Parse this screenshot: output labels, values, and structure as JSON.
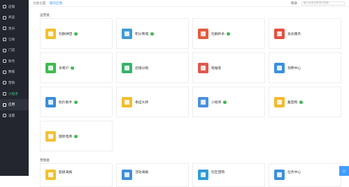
{
  "sidebar": {
    "items": [
      {
        "label": "店铺",
        "icon": "shop-icon",
        "active": false
      },
      {
        "label": "商品",
        "icon": "goods-icon",
        "active": false
      },
      {
        "label": "会员",
        "icon": "member-icon",
        "active": false
      },
      {
        "label": "订单",
        "icon": "order-icon",
        "active": false
      },
      {
        "label": "门店",
        "icon": "store-icon",
        "active": false
      },
      {
        "label": "财务",
        "icon": "finance-icon",
        "active": false
      },
      {
        "label": "数据",
        "icon": "data-icon",
        "active": false
      },
      {
        "label": "营销",
        "icon": "marketing-icon",
        "active": false
      },
      {
        "label": "小程序",
        "icon": "miniapp-icon",
        "active": false,
        "highlight": true
      },
      {
        "label": "应用",
        "icon": "apps-icon",
        "active": true
      },
      {
        "label": "设置",
        "icon": "settings-icon",
        "active": false
      }
    ]
  },
  "topbar": {
    "breadcrumb_prefix": "功能位置:",
    "breadcrumb_current": "我的应用",
    "help_label": "帮助",
    "search_placeholder": "输入应用名称进行检索"
  },
  "sections": [
    {
      "title": "运营类",
      "apps": [
        {
          "name": "社群拼团",
          "color": "#f2c12e",
          "icon": "group-buy-icon",
          "installed": true
        },
        {
          "name": "积分商城",
          "color": "#3e9bd6",
          "icon": "points-mall-icon",
          "installed": true
        },
        {
          "name": "社群秒杀",
          "color": "#e55b3c",
          "icon": "flash-sale-icon",
          "installed": true
        },
        {
          "name": "会员服务",
          "color": "#e84e3f",
          "icon": "member-service-icon",
          "installed": false
        },
        {
          "name": "多商户",
          "color": "#3dbb4f",
          "icon": "multi-merchant-icon",
          "installed": true
        },
        {
          "name": "店铺分销",
          "color": "#38b36a",
          "icon": "distribution-icon",
          "installed": false
        },
        {
          "name": "帮推客",
          "color": "#e0574a",
          "icon": "promoter-icon",
          "installed": false
        },
        {
          "name": "领券中心",
          "color": "#3c8fe0",
          "icon": "coupon-center-icon",
          "installed": false
        },
        {
          "name": "砍价助手",
          "color": "#3a8ed8",
          "icon": "bargain-icon",
          "installed": true
        },
        {
          "name": "幸运大转",
          "color": "#f2be2b",
          "icon": "lucky-wheel-icon",
          "installed": false
        },
        {
          "name": "小程序",
          "color": "#4a8fe0",
          "icon": "miniprogram-icon",
          "installed": true
        },
        {
          "name": "集团购",
          "color": "#f4b92f",
          "icon": "group-purchase-icon",
          "installed": true
        },
        {
          "name": "国际电商",
          "color": "#f4c13a",
          "icon": "cross-border-icon",
          "installed": true
        }
      ]
    },
    {
      "title": "营销类",
      "apps": [
        {
          "name": "超级海报",
          "color": "#f2c12e",
          "icon": "poster-icon",
          "installed": false
        },
        {
          "name": "活动海报",
          "color": "#3e8fdb",
          "icon": "event-poster-icon",
          "installed": false
        },
        {
          "name": "社区团购",
          "color": "#2f9bd8",
          "icon": "community-icon",
          "installed": false
        },
        {
          "name": "任务中心",
          "color": "#3e8fe0",
          "icon": "task-center-icon",
          "installed": false
        }
      ]
    }
  ],
  "check_glyph": "✓",
  "corner_button_glyph": "⌂"
}
